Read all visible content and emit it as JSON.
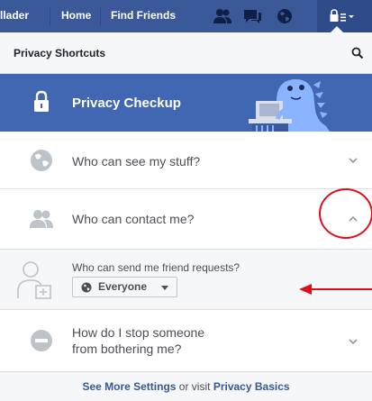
{
  "topbar": {
    "profile_name": "llader",
    "home_label": "Home",
    "find_friends_label": "Find Friends",
    "icons": [
      "friend-requests-icon",
      "messages-icon",
      "notifications-globe-icon",
      "privacy-shortcuts-icon"
    ],
    "bg_color": "#3b5998"
  },
  "shortcuts": {
    "title": "Privacy Shortcuts",
    "search_icon": "search-icon"
  },
  "checkup": {
    "title": "Privacy Checkup",
    "bg_color": "#4267b2"
  },
  "items": [
    {
      "label": "Who can see my stuff?",
      "icon": "globe-icon",
      "expanded": false
    },
    {
      "label": "Who can contact me?",
      "icon": "friends-icon",
      "expanded": true
    },
    {
      "label_line1": "How do I stop someone",
      "label_line2": "from bothering me?",
      "icon": "block-icon",
      "expanded": false
    }
  ],
  "contact_submenu": {
    "question": "Who can send me friend requests?",
    "audience": "Everyone"
  },
  "footer": {
    "see_more": "See More Settings",
    "or_visit": " or visit ",
    "privacy_basics": "Privacy Basics"
  },
  "annotation_color": "#e0101a"
}
